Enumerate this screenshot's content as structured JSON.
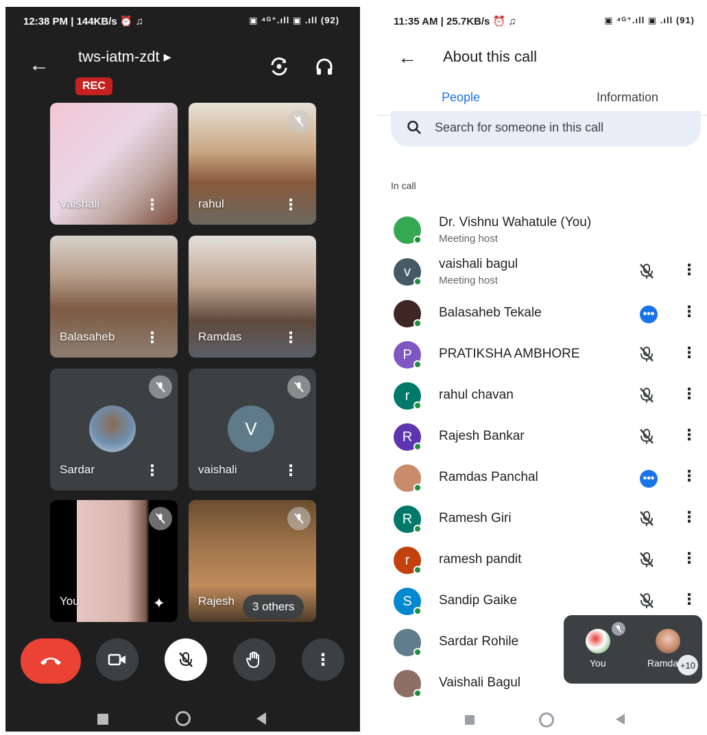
{
  "left_phone": {
    "status_bar": {
      "time_speed": "12:38 PM | 144KB/s ⏰ ♫",
      "signal": "▣ ⁴ᴳ⁺.ıll ▣ .ıll (92)"
    },
    "meeting_code": "tws-iatm-zdt ▸",
    "rec_label": "REC",
    "tiles": [
      {
        "name": "Vaishali"
      },
      {
        "name": "rahul"
      },
      {
        "name": "Balasaheb"
      },
      {
        "name": "Ramdas"
      },
      {
        "name": "Sardar"
      },
      {
        "name": "vaishali",
        "initial": "V"
      },
      {
        "name": "You"
      },
      {
        "name": "Rajesh"
      }
    ],
    "others_label": "3 others"
  },
  "right_phone": {
    "status_bar": {
      "time_speed": "11:35 AM | 25.7KB/s ⏰ ♫",
      "signal": "▣ ⁴ᴳ⁺.ıll ▣ .ıll (91)"
    },
    "title": "About this call",
    "tabs": {
      "people": "People",
      "information": "Information"
    },
    "search_placeholder": "Search for someone in this call",
    "section_label": "In call",
    "participants": [
      {
        "name": "Dr. Vishnu Wahatule (You)",
        "role": "Meeting host",
        "initial": "",
        "color": "#34a853",
        "status": "none"
      },
      {
        "name": "vaishali bagul",
        "role": "Meeting host",
        "initial": "v",
        "color": "#455a64",
        "status": "muted"
      },
      {
        "name": "Balasaheb Tekale",
        "role": "",
        "initial": "",
        "color": "#3e2723",
        "status": "speaking"
      },
      {
        "name": "PRATIKSHA AMBHORE",
        "role": "",
        "initial": "P",
        "color": "#7e57c2",
        "status": "muted"
      },
      {
        "name": "rahul chavan",
        "role": "",
        "initial": "r",
        "color": "#00796b",
        "status": "muted"
      },
      {
        "name": "Rajesh Bankar",
        "role": "",
        "initial": "R",
        "color": "#5e35b1",
        "status": "muted"
      },
      {
        "name": "Ramdas Panchal",
        "role": "",
        "initial": "",
        "color": "#c98b6b",
        "status": "speaking"
      },
      {
        "name": "Ramesh Giri",
        "role": "",
        "initial": "R",
        "color": "#00796b",
        "status": "muted"
      },
      {
        "name": "ramesh pandit",
        "role": "",
        "initial": "r",
        "color": "#c2410c",
        "status": "muted"
      },
      {
        "name": "Sandip Gaike",
        "role": "",
        "initial": "S",
        "color": "#0288d1",
        "status": "muted"
      },
      {
        "name": "Sardar Rohile",
        "role": "",
        "initial": "",
        "color": "#607d8b",
        "status": "none"
      },
      {
        "name": "Vaishali Bagul",
        "role": "",
        "initial": "",
        "color": "#8d6e63",
        "status": "none"
      }
    ],
    "pip": {
      "you_label": "You",
      "other_label": "Ramda",
      "count_label": "+10"
    }
  },
  "colors": {
    "accent": "#1a73e8",
    "end_call": "#ea4335",
    "online": "#1e8e3e",
    "rec": "#c5221f"
  }
}
